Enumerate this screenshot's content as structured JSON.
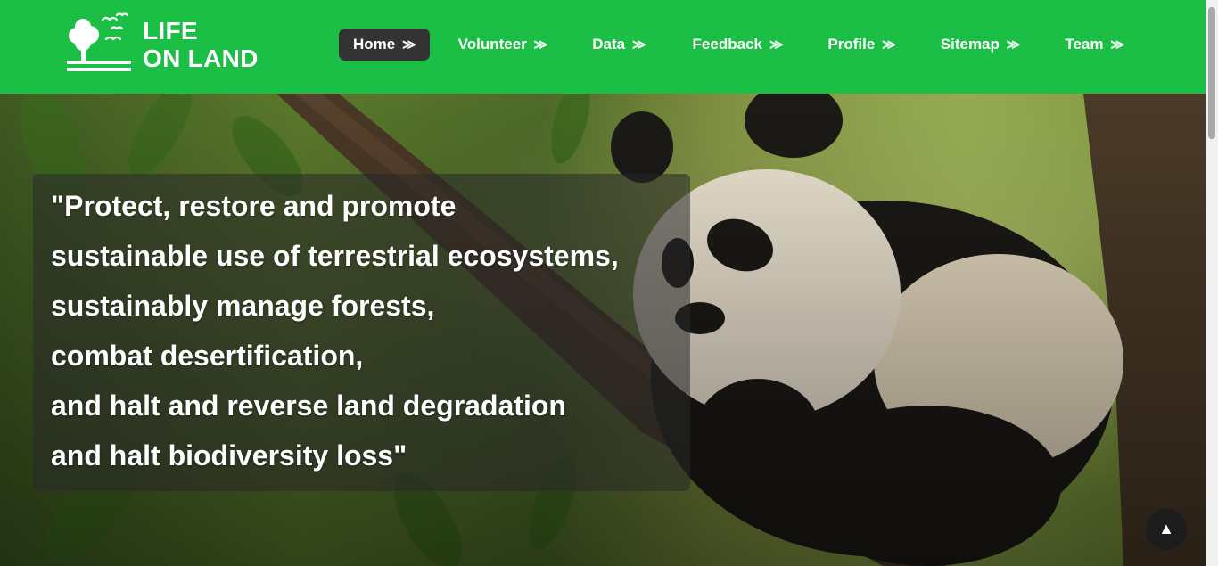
{
  "brand": {
    "line1": "LIFE",
    "line2": "ON LAND",
    "logo_icon": "tree-birds-icon"
  },
  "nav": {
    "items": [
      {
        "label": "Home",
        "active": true
      },
      {
        "label": "Volunteer",
        "active": false
      },
      {
        "label": "Data",
        "active": false
      },
      {
        "label": "Feedback",
        "active": false
      },
      {
        "label": "Profile",
        "active": false
      },
      {
        "label": "Sitemap",
        "active": false
      },
      {
        "label": "Team",
        "active": false
      }
    ],
    "arrow": "≫"
  },
  "hero": {
    "quote_lines": [
      "\"Protect, restore and promote",
      "sustainable use of terrestrial ecosystems,",
      "sustainably manage forests,",
      "combat desertification,",
      "and halt and reverse land degradation",
      "and halt biodiversity loss\""
    ]
  },
  "scroll_top": {
    "icon": "▲"
  },
  "colors": {
    "nav_bg": "#1cbf45",
    "active_tab": "#333333",
    "text": "#ffffff"
  }
}
